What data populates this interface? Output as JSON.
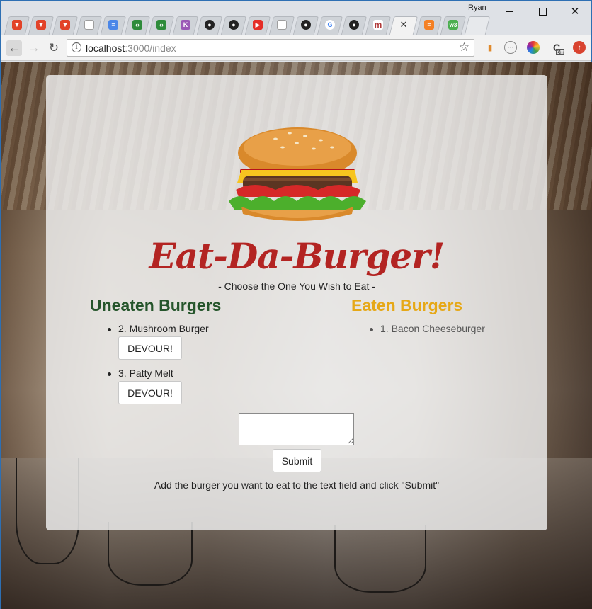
{
  "browser": {
    "profile_name": "Ryan",
    "tabs": [
      {
        "icon": "gitlab-icon",
        "color": "#e24329"
      },
      {
        "icon": "gitlab-icon",
        "color": "#e24329"
      },
      {
        "icon": "gitlab-icon",
        "color": "#e24329"
      },
      {
        "icon": "page-icon",
        "color": "#9e9e9e"
      },
      {
        "icon": "docs-icon",
        "color": "#4a86e8"
      },
      {
        "icon": "code-icon",
        "color": "#2e8b3a"
      },
      {
        "icon": "code-icon",
        "color": "#2e8b3a"
      },
      {
        "icon": "k-icon",
        "color": "#9b59b6"
      },
      {
        "icon": "github-icon",
        "color": "#222222"
      },
      {
        "icon": "github-icon",
        "color": "#222222"
      },
      {
        "icon": "youtube-icon",
        "color": "#e52d27"
      },
      {
        "icon": "page-icon",
        "color": "#9e9e9e"
      },
      {
        "icon": "github-icon",
        "color": "#222222"
      },
      {
        "icon": "google-icon",
        "color": "#4285f4"
      },
      {
        "icon": "github-icon",
        "color": "#222222"
      },
      {
        "icon": "m-icon",
        "color": "#b03a3a"
      }
    ],
    "active_tab_close": "✕",
    "trailing_tabs": [
      {
        "icon": "stackoverflow-icon",
        "color": "#f48024"
      },
      {
        "icon": "w3-icon",
        "color": "#4caf50"
      }
    ],
    "url_host": "localhost",
    "url_path": ":3000/index",
    "extensions": [
      {
        "icon": "bookmark-ext-icon",
        "color": "#e08a2c"
      },
      {
        "icon": "dev-ext-icon",
        "color": "#888888"
      },
      {
        "icon": "color-wheel-ext-icon",
        "color": "#e53935"
      },
      {
        "icon": "cookie-ext-icon",
        "color": "#333333"
      },
      {
        "icon": "update-ext-icon",
        "color": "#d9432f"
      }
    ],
    "ext_off_badge": "off"
  },
  "page": {
    "title": "Eat-Da-Burger!",
    "subtitle": "- Choose the One You Wish to Eat -",
    "uneaten_heading": "Uneaten Burgers",
    "eaten_heading": "Eaten Burgers",
    "uneaten": [
      {
        "label": "2. Mushroom Burger",
        "button": "DEVOUR!"
      },
      {
        "label": "3. Patty Melt",
        "button": "DEVOUR!"
      }
    ],
    "eaten": [
      {
        "label": "1. Bacon Cheeseburger"
      }
    ],
    "textarea_value": "",
    "submit_label": "Submit",
    "hint": "Add the burger you want to eat to the text field and click \"Submit\"",
    "colors": {
      "title": "#b32422",
      "uneaten_heading": "#25552b",
      "eaten_heading": "#e6a817"
    }
  }
}
